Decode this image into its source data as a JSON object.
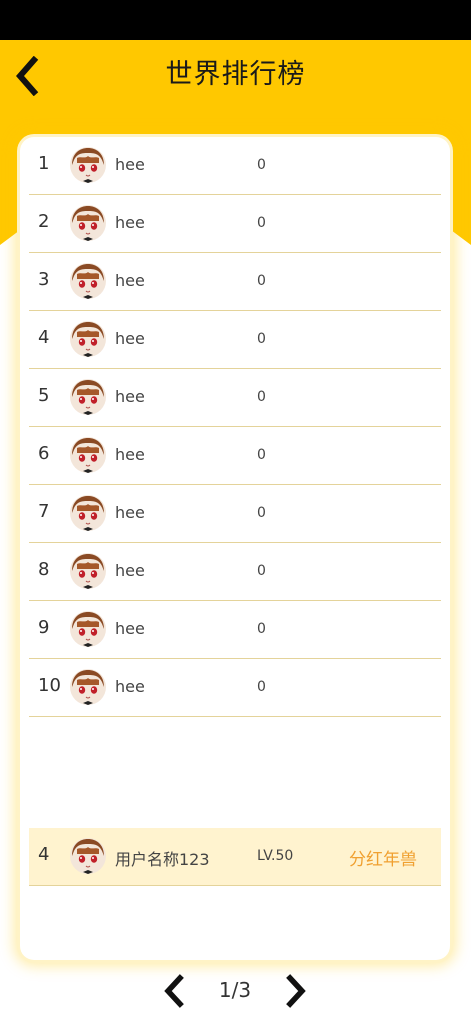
{
  "header": {
    "title": "世界排行榜",
    "back_icon": "chevron-left-icon"
  },
  "colors": {
    "accent": "#ffc800",
    "row_divider": "#e4d39a",
    "highlight_bg": "#fff3cf",
    "title_orange": "#f0a030"
  },
  "rankings": [
    {
      "rank": "1",
      "name": "hee",
      "score": "0"
    },
    {
      "rank": "2",
      "name": "hee",
      "score": "0"
    },
    {
      "rank": "3",
      "name": "hee",
      "score": "0"
    },
    {
      "rank": "4",
      "name": "hee",
      "score": "0"
    },
    {
      "rank": "5",
      "name": "hee",
      "score": "0"
    },
    {
      "rank": "6",
      "name": "hee",
      "score": "0"
    },
    {
      "rank": "7",
      "name": "hee",
      "score": "0"
    },
    {
      "rank": "8",
      "name": "hee",
      "score": "0"
    },
    {
      "rank": "9",
      "name": "hee",
      "score": "0"
    },
    {
      "rank": "10",
      "name": "hee",
      "score": "0"
    }
  ],
  "me": {
    "rank": "4",
    "name": "用户名称123",
    "level": "LV.50",
    "title": "分红年兽"
  },
  "pager": {
    "label": "1/3",
    "prev_icon": "chevron-left-icon",
    "next_icon": "chevron-right-icon"
  }
}
